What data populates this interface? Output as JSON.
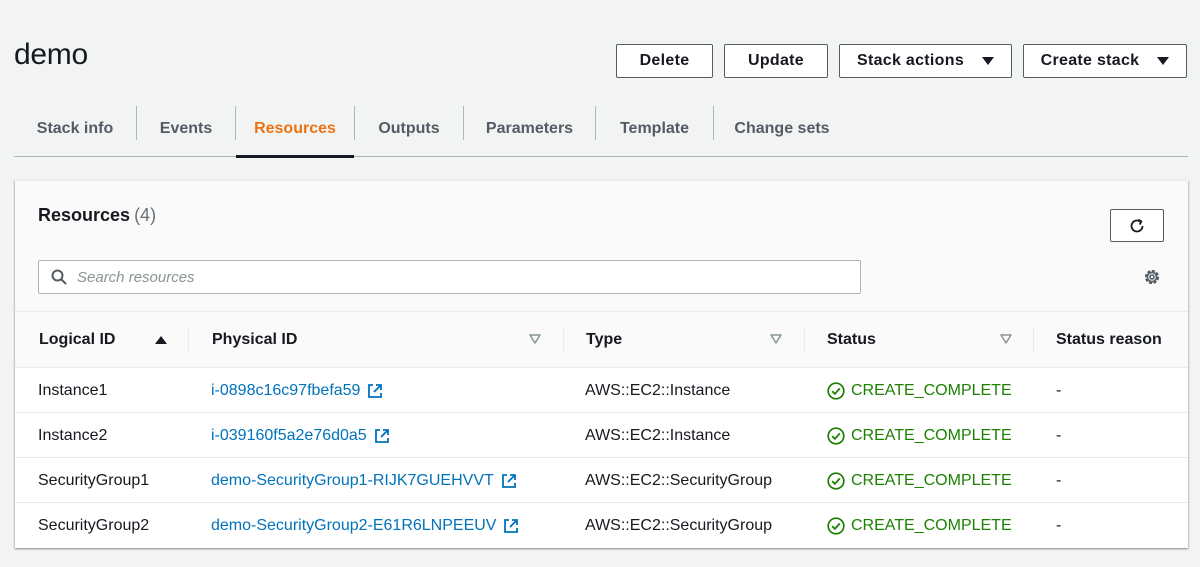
{
  "page": {
    "title": "demo"
  },
  "header_buttons": {
    "delete": "Delete",
    "update": "Update",
    "stack_actions": "Stack actions",
    "create_stack": "Create stack"
  },
  "tabs": [
    {
      "label": "Stack info",
      "active": false
    },
    {
      "label": "Events",
      "active": false
    },
    {
      "label": "Resources",
      "active": true
    },
    {
      "label": "Outputs",
      "active": false
    },
    {
      "label": "Parameters",
      "active": false
    },
    {
      "label": "Template",
      "active": false
    },
    {
      "label": "Change sets",
      "active": false
    }
  ],
  "resources": {
    "title": "Resources",
    "count": "(4)",
    "search_placeholder": "Search resources",
    "columns": [
      "Logical ID",
      "Physical ID",
      "Type",
      "Status",
      "Status reason"
    ],
    "rows": [
      {
        "logical_id": "Instance1",
        "physical_id": "i-0898c16c97fbefa59",
        "type": "AWS::EC2::Instance",
        "status": "CREATE_COMPLETE",
        "reason": "-"
      },
      {
        "logical_id": "Instance2",
        "physical_id": "i-039160f5a2e76d0a5",
        "type": "AWS::EC2::Instance",
        "status": "CREATE_COMPLETE",
        "reason": "-"
      },
      {
        "logical_id": "SecurityGroup1",
        "physical_id": "demo-SecurityGroup1-RIJK7GUEHVVT",
        "type": "AWS::EC2::SecurityGroup",
        "status": "CREATE_COMPLETE",
        "reason": "-"
      },
      {
        "logical_id": "SecurityGroup2",
        "physical_id": "demo-SecurityGroup2-E61R6LNPEEUV",
        "type": "AWS::EC2::SecurityGroup",
        "status": "CREATE_COMPLETE",
        "reason": "-"
      }
    ]
  },
  "colors": {
    "accent_tab": "#ec7211",
    "link": "#0073bb",
    "success": "#1d8102",
    "background": "#f2f3f3"
  },
  "icons": {
    "sort_ascending": "caret-up-icon",
    "sort_descending": "caret-down-outline-icon",
    "external_link": "external-link-icon",
    "status_ok": "check-circle-icon",
    "refresh": "refresh-icon",
    "settings": "gear-icon",
    "search": "search-icon"
  }
}
